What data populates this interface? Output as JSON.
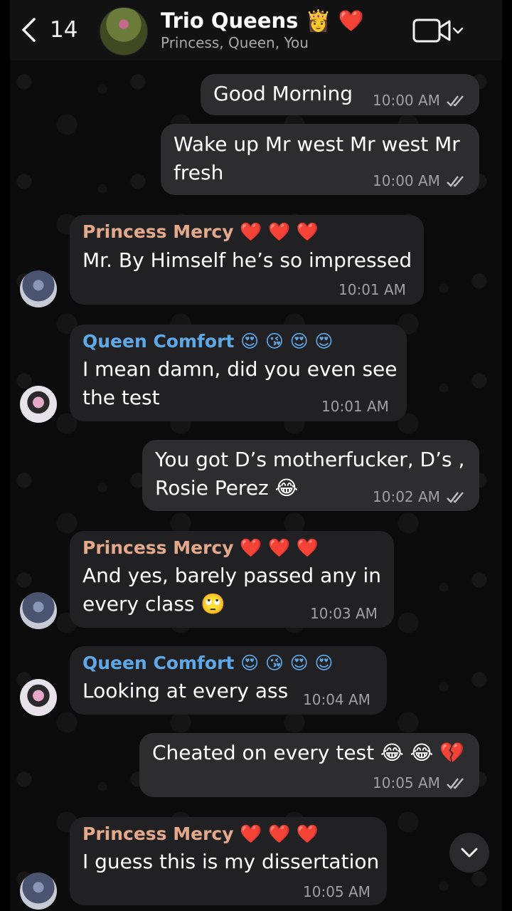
{
  "header": {
    "back_count": "14",
    "title": "Trio Queens 👸 ❤️",
    "subtitle": "Princess, Queen, You",
    "video_icon": "video-call-icon"
  },
  "colors": {
    "mercy_name": "#e4a88a",
    "comfort_name": "#5fa8e8",
    "outgoing_bubble": "#2d2d2f",
    "incoming_bubble": "#212123"
  },
  "messages": [
    {
      "id": "m1",
      "direction": "out",
      "lines": [
        "Good Morning"
      ],
      "time": "10:00 AM"
    },
    {
      "id": "m2",
      "direction": "out",
      "lines": [
        "Wake up Mr west Mr west Mr",
        "fresh"
      ],
      "time": "10:00 AM"
    },
    {
      "id": "m3",
      "direction": "in",
      "sender": "Princess Mercy ❤️ ❤️ ❤️",
      "lines": [
        "Mr. By Himself he’s so impressed"
      ],
      "time": "10:01 AM"
    },
    {
      "id": "m4",
      "direction": "in",
      "sender": "Queen Comfort 😍 😘 😍 😍",
      "lines": [
        "I mean damn, did you even see",
        "the test"
      ],
      "time": "10:01 AM"
    },
    {
      "id": "m5",
      "direction": "out",
      "lines": [
        "You got D’s motherfucker, D’s ,",
        "Rosie Perez 😂"
      ],
      "time": "10:02 AM"
    },
    {
      "id": "m6",
      "direction": "in",
      "sender": "Princess Mercy ❤️ ❤️ ❤️",
      "lines": [
        "And yes, barely passed any in",
        "every class 🙄"
      ],
      "time": "10:03 AM"
    },
    {
      "id": "m7",
      "direction": "in",
      "sender": "Queen Comfort 😍 😘 😍 😍",
      "lines": [
        "Looking at every ass"
      ],
      "time": "10:04 AM"
    },
    {
      "id": "m8",
      "direction": "out",
      "lines": [
        "Cheated on every test 😂 😂 💔"
      ],
      "time": "10:05 AM"
    },
    {
      "id": "m9",
      "direction": "in",
      "sender": "Princess Mercy ❤️ ❤️ ❤️",
      "lines": [
        "I guess this is my dissertation"
      ],
      "time": "10:05 AM"
    }
  ]
}
